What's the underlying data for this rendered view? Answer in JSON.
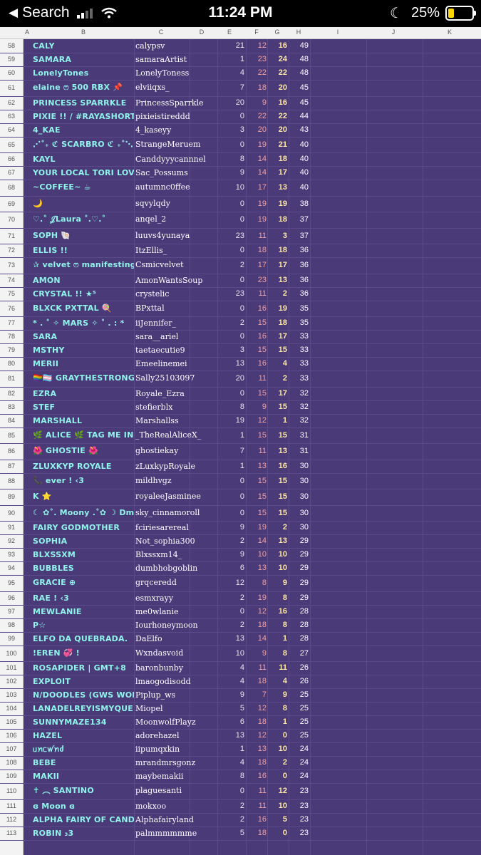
{
  "status_bar": {
    "back_label": "Search",
    "time": "11:24 PM",
    "battery": "25%",
    "battery_level": 0.25
  },
  "columns": [
    "A",
    "B",
    "C",
    "D",
    "E",
    "F",
    "G",
    "H",
    "I",
    "J",
    "K"
  ],
  "rows": [
    {
      "n": "58",
      "b": "CALY",
      "c": "calypsv",
      "e": "21",
      "f": "12",
      "g": "16",
      "h": "49"
    },
    {
      "n": "59",
      "b": "SAMARA",
      "c": "samaraArtist",
      "e": "1",
      "f": "23",
      "g": "24",
      "h": "48"
    },
    {
      "n": "60",
      "b": "LonelyTones",
      "c": "LonelyToness",
      "e": "4",
      "f": "22",
      "g": "22",
      "h": "48"
    },
    {
      "n": "61",
      "b": "elaine ෆ 500 RBX 📌",
      "c": "elviiqxs_",
      "e": "7",
      "f": "18",
      "g": "20",
      "h": "45"
    },
    {
      "n": "62",
      "b": "PRINCESS SPARRKLE",
      "c": "PrincessSparrkle",
      "e": "20",
      "f": "9",
      "g": "16",
      "h": "45"
    },
    {
      "n": "63",
      "b": "PIXIE !! / #RAYASHORTCAK",
      "c": "pixieistireddd",
      "e": "0",
      "f": "22",
      "g": "22",
      "h": "44"
    },
    {
      "n": "64",
      "b": "4_KAE",
      "c": "4_kaseyy",
      "e": "3",
      "f": "20",
      "g": "20",
      "h": "43"
    },
    {
      "n": "65",
      "b": "⋰˚₊ ℭ SCARBRO ℭ ₊˚⋱",
      "c": "StrangeMeruem",
      "e": "0",
      "f": "19",
      "g": "21",
      "h": "40"
    },
    {
      "n": "66",
      "b": "KAYL",
      "c": "Canddyyycannnel",
      "e": "8",
      "f": "14",
      "g": "18",
      "h": "40"
    },
    {
      "n": "67",
      "b": "YOUR LOCAL TORI LOVER",
      "c": "Sac_Possums",
      "e": "9",
      "f": "14",
      "g": "17",
      "h": "40"
    },
    {
      "n": "68",
      "b": "~COFFEE~ ☕",
      "c": "autumnc0ffee",
      "e": "10",
      "f": "17",
      "g": "13",
      "h": "40"
    },
    {
      "n": "69",
      "b": "🌙",
      "c": "sqvylqdy",
      "e": "0",
      "f": "19",
      "g": "19",
      "h": "38"
    },
    {
      "n": "70",
      "b": "♡.˚ 𝒥Laura ˚.♡.˚",
      "c": "anqel_2",
      "e": "0",
      "f": "19",
      "g": "18",
      "h": "37"
    },
    {
      "n": "71",
      "b": "SOPH 🐚",
      "c": "luuvs4yunaya",
      "e": "23",
      "f": "11",
      "g": "3",
      "h": "37"
    },
    {
      "n": "72",
      "b": "ELLIS !!",
      "c": "ItzEllis_",
      "e": "0",
      "f": "18",
      "g": "18",
      "h": "36"
    },
    {
      "n": "73",
      "b": "✰ velvet ෆ manifesting",
      "c": "Csmicvelvet",
      "e": "2",
      "f": "17",
      "g": "17",
      "h": "36"
    },
    {
      "n": "74",
      "b": "AMON",
      "c": "AmonWantsSoup",
      "e": "0",
      "f": "23",
      "g": "13",
      "h": "36"
    },
    {
      "n": "75",
      "b": "CRYSTAL !! ★⁵",
      "c": "crystelic",
      "e": "23",
      "f": "11",
      "g": "2",
      "h": "36"
    },
    {
      "n": "76",
      "b": "BLXCK PXTTAL 🍭",
      "c": "BPxttal",
      "e": "0",
      "f": "16",
      "g": "19",
      "h": "35"
    },
    {
      "n": "77",
      "b": "* . ˚ ✧ MARS ✧ ˚ . : *",
      "c": "iiJennifer_",
      "e": "2",
      "f": "15",
      "g": "18",
      "h": "35"
    },
    {
      "n": "78",
      "b": "SARA",
      "c": "sara__ariel",
      "e": "0",
      "f": "16",
      "g": "17",
      "h": "33"
    },
    {
      "n": "79",
      "b": "MSTHY",
      "c": "taetaecutie9",
      "e": "3",
      "f": "15",
      "g": "15",
      "h": "33"
    },
    {
      "n": "80",
      "b": "MERII",
      "c": "Emeelinemei",
      "e": "13",
      "f": "16",
      "g": "4",
      "h": "33"
    },
    {
      "n": "81",
      "b": "🏳️‍🌈🏳️‍⚧️ GRAYTHESTRONGM",
      "c": "Sally25103097",
      "e": "20",
      "f": "11",
      "g": "2",
      "h": "33"
    },
    {
      "n": "82",
      "b": "EZRA",
      "c": "Royale_Ezra",
      "e": "0",
      "f": "15",
      "g": "17",
      "h": "32"
    },
    {
      "n": "83",
      "b": "STEF",
      "c": "stefierblx",
      "e": "8",
      "f": "9",
      "g": "15",
      "h": "32"
    },
    {
      "n": "84",
      "b": "MARSHALL",
      "c": "Marshallss",
      "e": "19",
      "f": "12",
      "g": "1",
      "h": "32"
    },
    {
      "n": "85",
      "b": "🌿 ALICE 🌿 TAG ME IN GWS",
      "c": "_TheRealAliceX_",
      "e": "1",
      "f": "15",
      "g": "15",
      "h": "31"
    },
    {
      "n": "86",
      "b": "🌺 GHOSTIE 🌺",
      "c": "ghostiekay",
      "e": "7",
      "f": "11",
      "g": "13",
      "h": "31"
    },
    {
      "n": "87",
      "b": "ZLUXKYP ROYALE",
      "c": "zLuxkypRoyale",
      "e": "1",
      "f": "13",
      "g": "16",
      "h": "30"
    },
    {
      "n": "88",
      "b": "📞 ever ! ‹3",
      "c": "mildhvgz",
      "e": "0",
      "f": "15",
      "g": "15",
      "h": "30"
    },
    {
      "n": "89",
      "b": "K ⭐",
      "c": "royaleeJasminee",
      "e": "0",
      "f": "15",
      "g": "15",
      "h": "30"
    },
    {
      "n": "90",
      "b": "☾ ✿˚. Moony .˚✿ ☽ Dm",
      "c": "sky_cinnamoroll",
      "e": "0",
      "f": "15",
      "g": "15",
      "h": "30"
    },
    {
      "n": "91",
      "b": "FAIRY GODMOTHER",
      "c": "fciriesarereal",
      "e": "9",
      "f": "19",
      "g": "2",
      "h": "30"
    },
    {
      "n": "92",
      "b": "SOPHIA",
      "c": "Not_sophia300",
      "e": "2",
      "f": "14",
      "g": "13",
      "h": "29"
    },
    {
      "n": "93",
      "b": "BLXSSXM",
      "c": "Blxssxm14_",
      "e": "9",
      "f": "10",
      "g": "10",
      "h": "29"
    },
    {
      "n": "94",
      "b": "BUBBLES",
      "c": "dumbhobgoblin",
      "e": "6",
      "f": "13",
      "g": "10",
      "h": "29"
    },
    {
      "n": "95",
      "b": "GRACIE ⊕",
      "c": "grqceredd",
      "e": "12",
      "f": "8",
      "g": "9",
      "h": "29"
    },
    {
      "n": "96",
      "b": "RAE ! ‹3",
      "c": "esmxrayy",
      "e": "2",
      "f": "19",
      "g": "8",
      "h": "29"
    },
    {
      "n": "97",
      "b": "MEWLANIE",
      "c": "me0wlanie",
      "e": "0",
      "f": "12",
      "g": "16",
      "h": "28"
    },
    {
      "n": "98",
      "b": "P☆",
      "c": "Iourhoneymoon",
      "e": "2",
      "f": "18",
      "g": "8",
      "h": "28"
    },
    {
      "n": "99",
      "b": "ELFO DA QUEBRADA.",
      "c": "DaElfo",
      "e": "13",
      "f": "14",
      "g": "1",
      "h": "28"
    },
    {
      "n": "100",
      "b": "!EREN 💞 !",
      "c": "Wxndasvoid",
      "e": "10",
      "f": "9",
      "g": "8",
      "h": "27"
    },
    {
      "n": "101",
      "b": "ROSAPIDER | GMT+8",
      "c": "baronbunby",
      "e": "4",
      "f": "11",
      "g": "11",
      "h": "26"
    },
    {
      "n": "102",
      "b": "EXPLOIT",
      "c": "lmaogodisodd",
      "e": "4",
      "f": "18",
      "g": "4",
      "h": "26"
    },
    {
      "n": "103",
      "b": "N/DOODLES (GWS WON: 4)",
      "c": "Piplup_ws",
      "e": "9",
      "f": "7",
      "g": "9",
      "h": "25"
    },
    {
      "n": "104",
      "b": "LANADELREYISMYQUEEN",
      "c": "Miopel",
      "e": "5",
      "f": "12",
      "g": "8",
      "h": "25"
    },
    {
      "n": "105",
      "b": "SUNNYMAZE134",
      "c": "MoonwolfPlayz",
      "e": "6",
      "f": "18",
      "g": "1",
      "h": "25"
    },
    {
      "n": "106",
      "b": "HAZEL",
      "c": "adorehazel",
      "e": "13",
      "f": "12",
      "g": "0",
      "h": "25"
    },
    {
      "n": "107",
      "b": "ᥙꪀᥴꪝꪀძ",
      "c": "iipumqxkin",
      "e": "1",
      "f": "13",
      "g": "10",
      "h": "24"
    },
    {
      "n": "108",
      "b": "BEBE",
      "c": "mrandmrsgonz",
      "e": "4",
      "f": "18",
      "g": "2",
      "h": "24"
    },
    {
      "n": "109",
      "b": "MAKII",
      "c": "maybemakii",
      "e": "8",
      "f": "16",
      "g": "0",
      "h": "24"
    },
    {
      "n": "110",
      "b": "✝ ︵ SANTINO",
      "c": "plaguesanti",
      "e": "0",
      "f": "11",
      "g": "12",
      "h": "23"
    },
    {
      "n": "111",
      "b": "ɞ Moon ɞ",
      "c": "mokxoo",
      "e": "2",
      "f": "11",
      "g": "10",
      "h": "23"
    },
    {
      "n": "112",
      "b": "ALPHA FAIRY OF CANDY LA",
      "c": "Alphafairyland",
      "e": "2",
      "f": "16",
      "g": "5",
      "h": "23"
    },
    {
      "n": "113",
      "b": "ROBIN ₃3",
      "c": "palmmmmmme",
      "e": "5",
      "f": "18",
      "g": "0",
      "h": "23"
    }
  ]
}
